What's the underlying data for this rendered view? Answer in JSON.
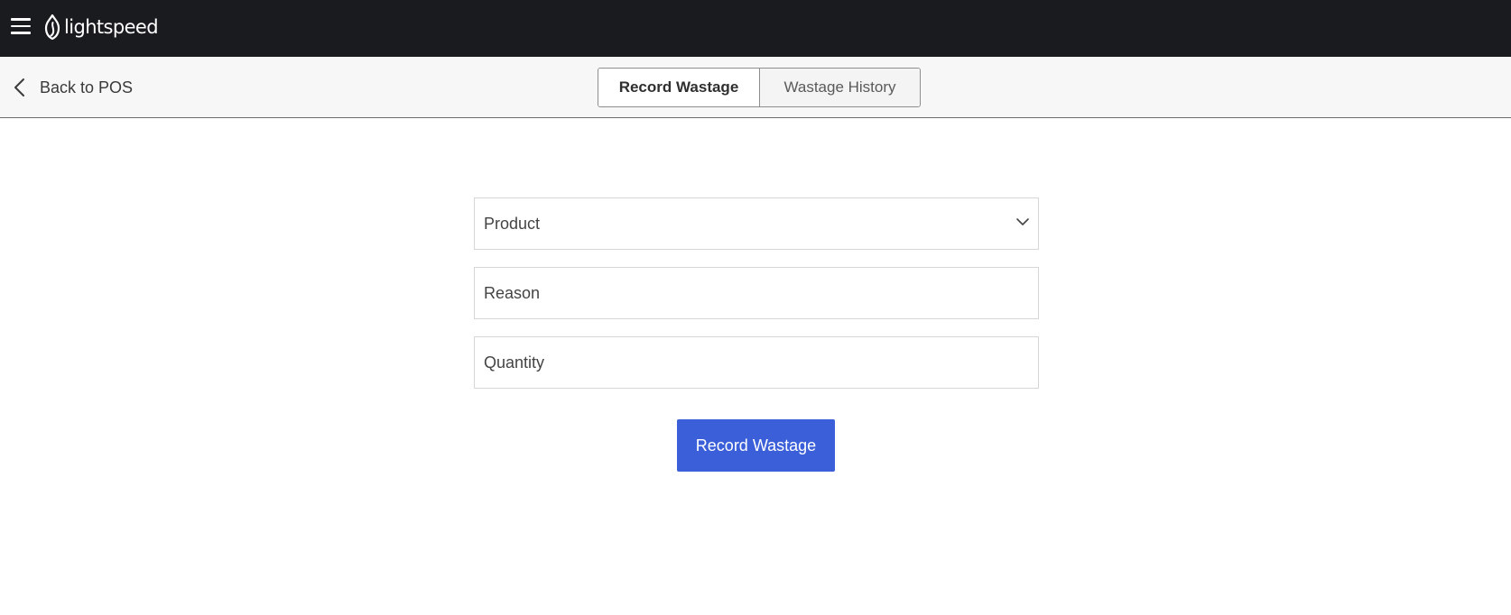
{
  "topbar": {
    "menu_icon": "hamburger-menu-icon",
    "logo_text": "lightspeed",
    "logo_icon": "lightspeed-flame-icon",
    "background_color": "#1a1b1f"
  },
  "subnav": {
    "back_label": "Back to POS",
    "back_icon": "chevron-left-icon",
    "tabs": [
      {
        "label": "Record Wastage",
        "active": true
      },
      {
        "label": "Wastage History",
        "active": false
      }
    ]
  },
  "form": {
    "product_placeholder": "Product",
    "product_icon": "chevron-down-icon",
    "reason_placeholder": "Reason",
    "quantity_placeholder": "Quantity",
    "submit_label": "Record Wastage",
    "accent_color": "#3b5fd9"
  }
}
